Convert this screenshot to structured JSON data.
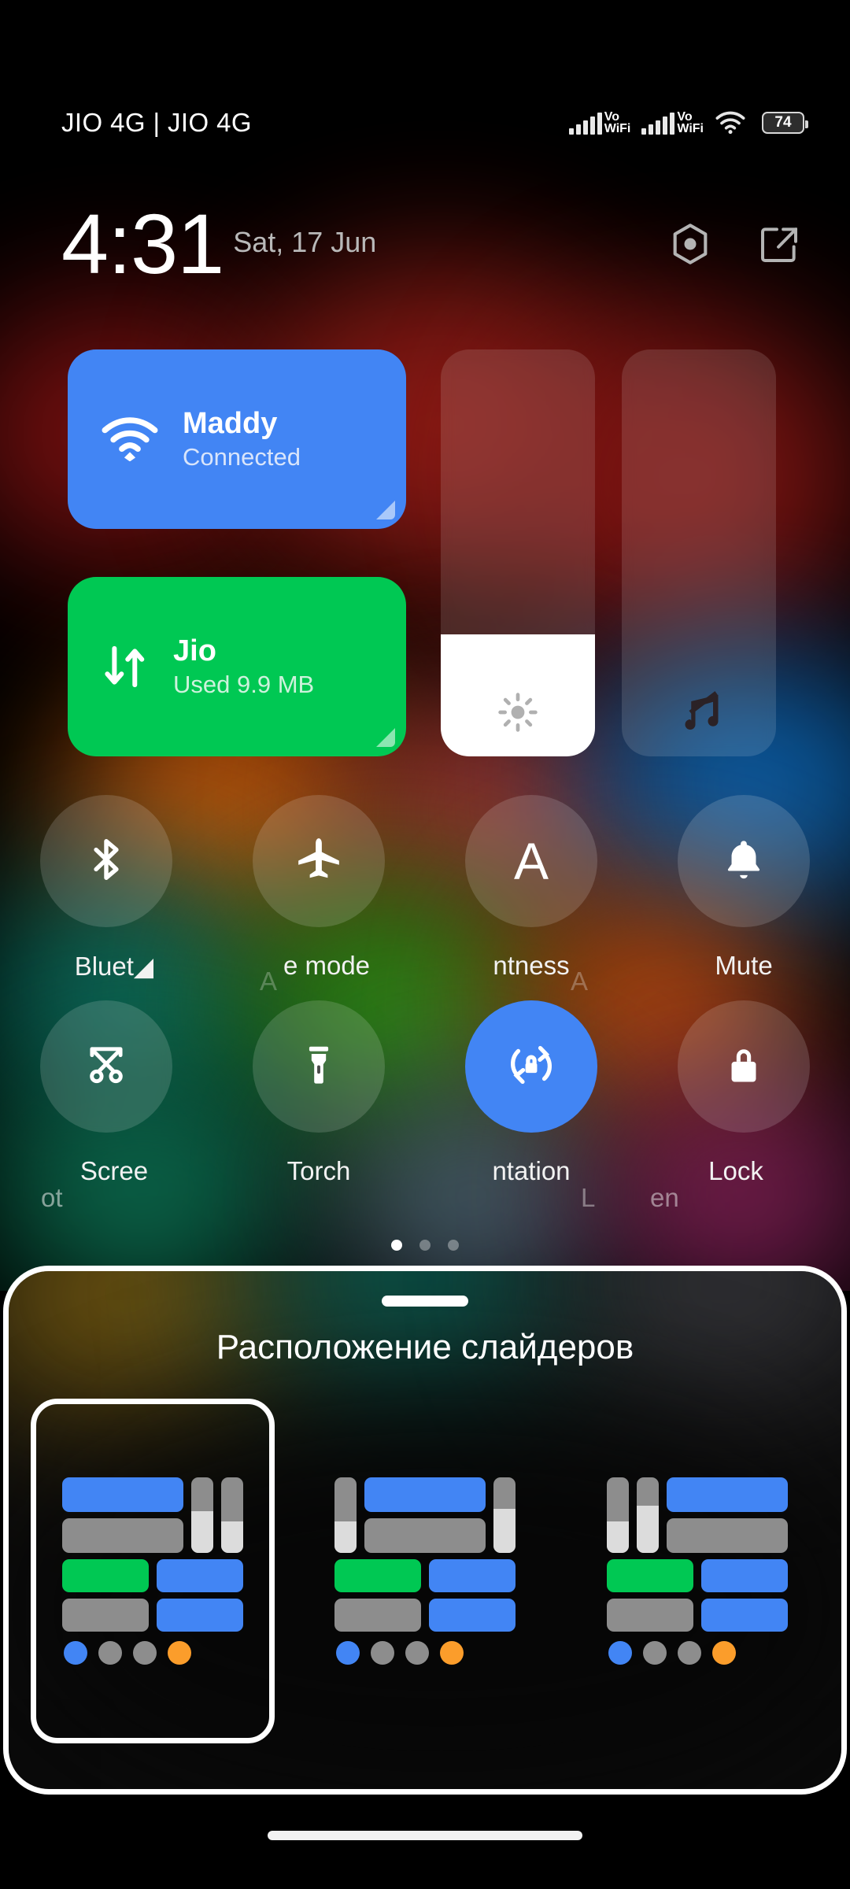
{
  "status_bar": {
    "carriers": "JIO 4G | JIO 4G",
    "sim1_signal_icon": "signal-bars-icon",
    "sim1_volte_label": "Vo",
    "sim1_wifi_label": "WiFi",
    "sim2_signal_icon": "signal-bars-icon",
    "sim2_volte_label": "Vo",
    "sim2_wifi_label": "WiFi",
    "wifi_icon": "wifi-icon",
    "battery_level": "74"
  },
  "header": {
    "time": "4:31",
    "date": "Sat, 17 Jun",
    "settings_icon": "gear-hexagon-icon",
    "edit_icon": "edit-pencil-square-icon"
  },
  "big_tiles": [
    {
      "name": "wifi",
      "icon": "wifi-icon",
      "title": "Maddy",
      "subtitle": "Connected",
      "color": "#4285F4",
      "expand_corner": true
    },
    {
      "name": "mobile-data",
      "icon": "data-transfer-arrows-icon",
      "title": "Jio",
      "subtitle": "Used 9.9 MB",
      "color": "#00C853",
      "expand_corner": true
    }
  ],
  "sliders": [
    {
      "name": "brightness",
      "icon": "sun-brightness-icon",
      "fill_percent": 30,
      "fill_color": "#FFFFFF"
    },
    {
      "name": "volume",
      "icon": "music-note-muted-icon",
      "fill_percent": 0,
      "fill_color": "#FFFFFF"
    }
  ],
  "toggles": {
    "row1": [
      {
        "name": "bluetooth",
        "icon": "bluetooth-icon",
        "label": "Bluet◢",
        "active": false,
        "label_state": "clipped"
      },
      {
        "name": "airplane-mode",
        "icon": "airplane-icon",
        "label": "e mode",
        "active": false,
        "label_state": "clipped"
      },
      {
        "name": "auto-brightness",
        "icon": "letter-a-icon",
        "label": "ntness",
        "active": false,
        "label_state": "clipped"
      },
      {
        "name": "auto-brightness-ghost",
        "icon": "none",
        "label": "A",
        "active": false,
        "label_state": "faded"
      },
      {
        "name": "mute",
        "icon": "bell-icon",
        "label": "Mute",
        "active": false,
        "label_state": "normal"
      }
    ],
    "row2": [
      {
        "name": "screenshot-ghost",
        "icon": "none",
        "label": "ot",
        "active": false,
        "label_state": "faded"
      },
      {
        "name": "screenshot",
        "icon": "scissors-screenshot-icon",
        "label": "Scree",
        "active": false,
        "label_state": "clipped"
      },
      {
        "name": "torch",
        "icon": "flashlight-icon",
        "label": "Torch",
        "active": false,
        "label_state": "normal"
      },
      {
        "name": "orientation-lock",
        "icon": "rotate-lock-icon",
        "label": "ntation",
        "active": true,
        "label_state": "clipped"
      },
      {
        "name": "lock-ghost",
        "icon": "none",
        "label": "L",
        "active": false,
        "label_state": "faded"
      },
      {
        "name": "lock-screen-partial",
        "icon": "none",
        "label": "en",
        "active": false,
        "label_state": "faded"
      },
      {
        "name": "lock",
        "icon": "padlock-icon",
        "label": "Lock",
        "active": false,
        "label_state": "clipped"
      }
    ]
  },
  "page_indicator": {
    "count": 3,
    "active_index": 0
  },
  "bottom_sheet": {
    "title": "Расположение слайдеров",
    "drag_handle": "drag-handle",
    "options": [
      {
        "name": "layout-option-1",
        "selected": true,
        "description": "tiles left, two vertical sliders right",
        "top": {
          "order": [
            "tiles",
            "slider",
            "slider"
          ],
          "slider_fill": [
            55,
            42
          ]
        },
        "tiles_top": [
          "#4285F4",
          "#8D8D8D"
        ],
        "row2": [
          "#00C853",
          "#4285F4"
        ],
        "row3": [
          "#8D8D8D",
          "#4285F4"
        ],
        "dots": [
          "#4285F4",
          "#8D8D8D",
          "#8D8D8D",
          "#FB9D2B"
        ]
      },
      {
        "name": "layout-option-2",
        "selected": false,
        "description": "slider left, tiles center, slider right",
        "top": {
          "order": [
            "slider",
            "tiles",
            "slider"
          ],
          "slider_fill": [
            42,
            58
          ]
        },
        "tiles_top": [
          "#4285F4",
          "#8D8D8D"
        ],
        "row2": [
          "#00C853",
          "#4285F4"
        ],
        "row3": [
          "#8D8D8D",
          "#4285F4"
        ],
        "dots": [
          "#4285F4",
          "#8D8D8D",
          "#8D8D8D",
          "#FB9D2B"
        ]
      },
      {
        "name": "layout-option-3",
        "selected": false,
        "description": "two vertical sliders left, tiles right",
        "top": {
          "order": [
            "slider",
            "slider",
            "tiles"
          ],
          "slider_fill": [
            42,
            62
          ]
        },
        "tiles_top": [
          "#4285F4",
          "#8D8D8D"
        ],
        "row2": [
          "#00C853",
          "#4285F4"
        ],
        "row3": [
          "#8D8D8D",
          "#4285F4"
        ],
        "dots": [
          "#4285F4",
          "#8D8D8D",
          "#8D8D8D",
          "#FB9D2B"
        ]
      }
    ]
  },
  "nav_bar": {
    "name": "gesture-home-bar"
  },
  "colors": {
    "accent_blue": "#4285F4",
    "accent_green": "#00C853",
    "accent_orange": "#FB9D2B",
    "slider_track": "#8D8D8D",
    "slider_fill": "#DCDCDC",
    "background": "#000000"
  }
}
